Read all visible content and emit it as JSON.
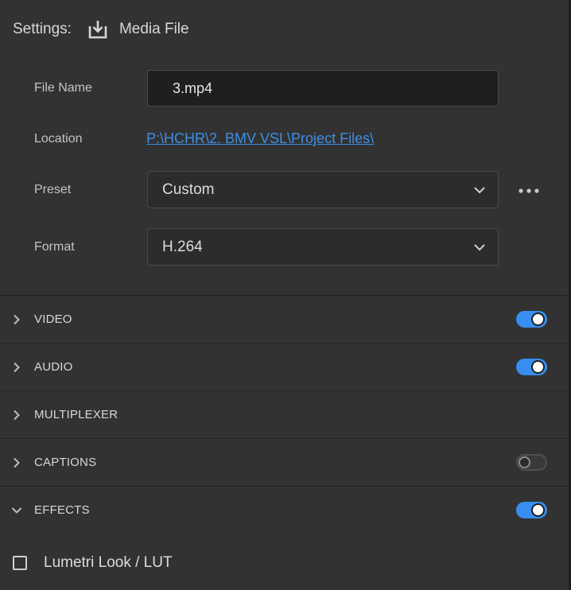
{
  "header": {
    "label": "Settings:",
    "icon": "export-download-icon",
    "value": "Media File"
  },
  "fields": {
    "file_name": {
      "label": "File Name",
      "value": "3.mp4"
    },
    "location": {
      "label": "Location",
      "value": "P:\\HCHR\\2. BMV VSL\\Project Files\\"
    },
    "preset": {
      "label": "Preset",
      "value": "Custom",
      "more_icon": "more-horizontal-icon"
    },
    "format": {
      "label": "Format",
      "value": "H.264"
    }
  },
  "sections": [
    {
      "label": "VIDEO",
      "expanded": false,
      "toggle": "on"
    },
    {
      "label": "AUDIO",
      "expanded": false,
      "toggle": "on"
    },
    {
      "label": "MULTIPLEXER",
      "expanded": false,
      "toggle": null
    },
    {
      "label": "CAPTIONS",
      "expanded": false,
      "toggle": "off"
    },
    {
      "label": "EFFECTS",
      "expanded": true,
      "toggle": "on"
    }
  ],
  "effects": {
    "lumetri": {
      "label": "Lumetri Look / LUT",
      "checked": false
    }
  },
  "colors": {
    "background": "#323232",
    "accent": "#378ef0",
    "link": "#3d8ee6"
  }
}
